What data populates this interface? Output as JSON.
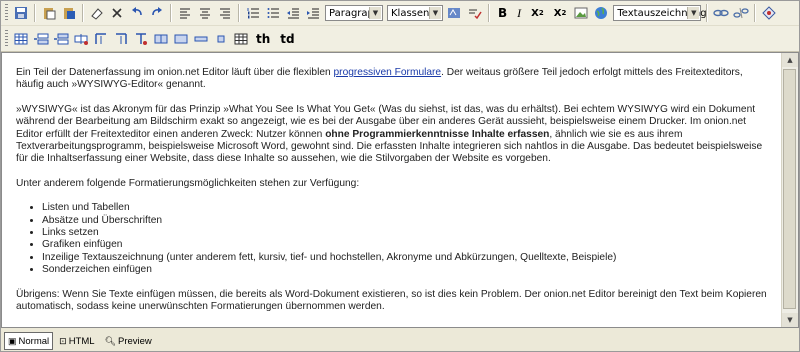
{
  "toolbar": {
    "block_select": "Paragraph",
    "class_select": "Klassen",
    "text_select": "Textauszeichnung",
    "th_label": "th",
    "td_label": "td"
  },
  "content": {
    "p1_pre": "Ein Teil der Datenerfassung im onion.net Editor läuft über die flexiblen ",
    "p1_link": "progressiven Formulare",
    "p1_post": ". Der weitaus größere Teil jedoch erfolgt mittels des Freitexteditors, häufig auch »WYSIWYG-Editor« genannt.",
    "p2_pre": "»WYSIWYG« ist das Akronym für das Prinzip »What You See Is What You Get« (Was du siehst, ist das, was du erhältst). Bei echtem WYSIWYG wird ein Dokument während der Bearbeitung am Bildschirm exakt so angezeigt, wie es bei der Ausgabe über ein anderes Gerät aussieht, beispielsweise einem Drucker. Im onion.net Editor erfüllt der Freitexteditor einen anderen Zweck: Nutzer können ",
    "p2_bold": "ohne Programmierkenntnisse Inhalte erfassen",
    "p2_post": ", ähnlich wie sie es aus ihrem Textverarbeitungsprogramm, beispielsweise Microsoft Word, gewohnt sind. Die erfassten Inhalte integrieren sich nahtlos in die Ausgabe. Das bedeutet beispielsweise für die Inhaltserfassung einer Website, dass diese Inhalte so aussehen, wie die Stilvorgaben der Website es vorgeben.",
    "p3": "Unter anderem folgende Formatierungsmöglichkeiten stehen zur Verfügung:",
    "list": [
      "Listen und Tabellen",
      "Absätze und Überschriften",
      "Links setzen",
      "Grafiken einfügen",
      "Inzeilige Textauszeichnung (unter anderem fett, kursiv, tief- und hochstellen, Akronyme und Abkürzungen, Quelltexte, Beispiele)",
      "Sonderzeichen einfügen"
    ],
    "p4": "Übrigens: Wenn Sie Texte einfügen müssen, die bereits als Word-Dokument existieren, so ist dies kein Problem. Der onion.net Editor bereinigt den Text beim Kopieren automatisch, sodass keine unerwünschten Formatierungen übernommen werden."
  },
  "modes": {
    "normal": "Normal",
    "html": "HTML",
    "preview": "Preview"
  }
}
